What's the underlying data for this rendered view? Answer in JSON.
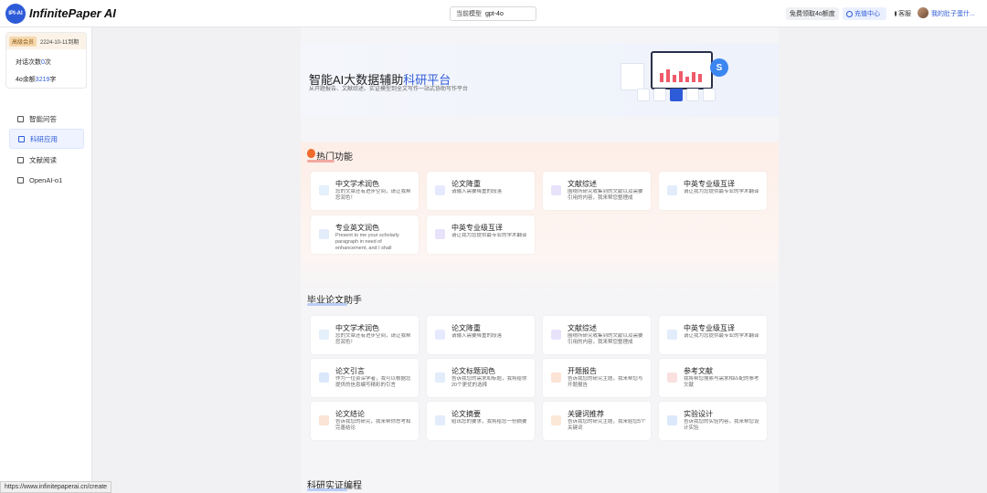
{
  "header": {
    "brand": "InfinitePaper AI",
    "logo_text": "IPI-AI",
    "model_label": "当前模型",
    "model_value": "gpt-4o",
    "free_btn": "免费领取4o额度",
    "recharge_btn": "充值中心",
    "service_btn": "客服",
    "user_name": "我的肚子蛋什..."
  },
  "sidebar": {
    "member_badge": "高级会员",
    "member_expiry": "2224-10-11到期",
    "quota1_label": "对话次数",
    "quota1_value": "0",
    "quota1_unit": "次",
    "quota2_label": "4o余额",
    "quota2_value": "3219",
    "quota2_unit": "字",
    "nav": [
      {
        "label": "智能问答"
      },
      {
        "label": "科研应用"
      },
      {
        "label": "文献阅读"
      },
      {
        "label": "OpenAI-o1"
      }
    ]
  },
  "banner": {
    "title_a": "智能AI大数据辅助",
    "title_b": "科研平台",
    "subtitle": "从开题报告、文献综述、实证模型到全文写作一站式协助写作平台"
  },
  "hot": {
    "title": "热门功能",
    "cards": [
      {
        "title": "中文学术润色",
        "desc": "您的文章还有进步空间，请让我帮您润色！"
      },
      {
        "title": "论文降重",
        "desc": "请输入需要降重的段落"
      },
      {
        "title": "文献综述",
        "desc": "围绕所研究收集到的文献以及需要引用的内容，我来帮您整理成"
      },
      {
        "title": "中英专业级互译",
        "desc": "请让我为您提供最专业的学术翻译"
      },
      {
        "title": "专业英文润色",
        "desc": "Present to me your scholarly paragraph in need of enhancement, and I shall"
      },
      {
        "title": "中英专业级互译",
        "desc": "请让我为您提供最专业的学术翻译"
      }
    ]
  },
  "thesis": {
    "title": "毕业论文助手",
    "cards": [
      {
        "title": "中文学术润色",
        "desc": "您的文章还有进步空间，请让我帮您润色！"
      },
      {
        "title": "论文降重",
        "desc": "请输入需要降重的段落"
      },
      {
        "title": "文献综述",
        "desc": "围绕所研究收集到的文献以及需要引用的内容，我来帮您整理成"
      },
      {
        "title": "中英专业级互译",
        "desc": "请让我为您提供最专业的学术翻译"
      },
      {
        "title": "论文引言",
        "desc": "作为一位资深学者，我可以根据您提供的信息编写精彩的引言"
      },
      {
        "title": "论文标题润色",
        "desc": "告诉我您的需求和标题，我将给你20个更优的选择"
      },
      {
        "title": "开题报告",
        "desc": "告诉我您的研究主题，我来帮您写开题报告"
      },
      {
        "title": "参考文献",
        "desc": "我将帮您搜索与需求相匹配的参考文献"
      },
      {
        "title": "论文结论",
        "desc": "告诉我您的研究，我来帮你思考和完善结论"
      },
      {
        "title": "论文摘要",
        "desc": "给出您的要求，我将给您一份摘要"
      },
      {
        "title": "关键词推荐",
        "desc": "告诉我您的研究主题，我来给您5个关键词"
      },
      {
        "title": "实验设计",
        "desc": "告诉我您的实验内容，我来帮您设计实验"
      }
    ]
  },
  "next_section": {
    "title": "科研实证编程"
  },
  "status_url": "https://www.infinitepaperai.cn/create",
  "colors": {
    "accent": "#2e5bd8",
    "hot_bg": "#fdeee7",
    "fire": "#f06a2c"
  }
}
